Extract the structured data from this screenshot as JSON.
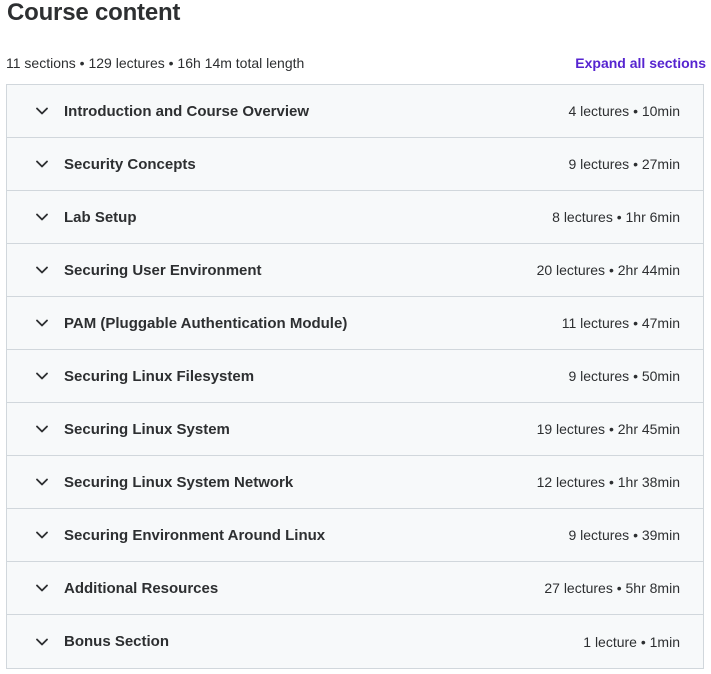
{
  "header": {
    "title": "Course content",
    "summary": "11 sections • 129 lectures • 16h 14m total length",
    "expand_label": "Expand all sections"
  },
  "colors": {
    "accent": "#5624d0",
    "row_background": "#f7f9fa",
    "border": "#d1d7dc",
    "text": "#2d2f31"
  },
  "sections": [
    {
      "title": "Introduction and Course Overview",
      "meta": "4 lectures • 10min",
      "icon": "chevron-down-icon"
    },
    {
      "title": "Security Concepts",
      "meta": "9 lectures • 27min",
      "icon": "chevron-down-icon"
    },
    {
      "title": "Lab Setup",
      "meta": "8 lectures • 1hr 6min",
      "icon": "chevron-down-icon"
    },
    {
      "title": "Securing User Environment",
      "meta": "20 lectures • 2hr 44min",
      "icon": "chevron-down-icon"
    },
    {
      "title": "PAM (Pluggable Authentication Module)",
      "meta": "11 lectures • 47min",
      "icon": "chevron-down-icon"
    },
    {
      "title": "Securing Linux Filesystem",
      "meta": "9 lectures • 50min",
      "icon": "chevron-down-icon"
    },
    {
      "title": "Securing Linux System",
      "meta": "19 lectures • 2hr 45min",
      "icon": "chevron-down-icon"
    },
    {
      "title": "Securing Linux System Network",
      "meta": "12 lectures • 1hr 38min",
      "icon": "chevron-down-icon"
    },
    {
      "title": "Securing Environment Around Linux",
      "meta": "9 lectures • 39min",
      "icon": "chevron-down-icon"
    },
    {
      "title": "Additional Resources",
      "meta": "27 lectures • 5hr 8min",
      "icon": "chevron-down-icon"
    },
    {
      "title": "Bonus Section",
      "meta": "1 lecture • 1min",
      "icon": "chevron-down-icon"
    }
  ]
}
